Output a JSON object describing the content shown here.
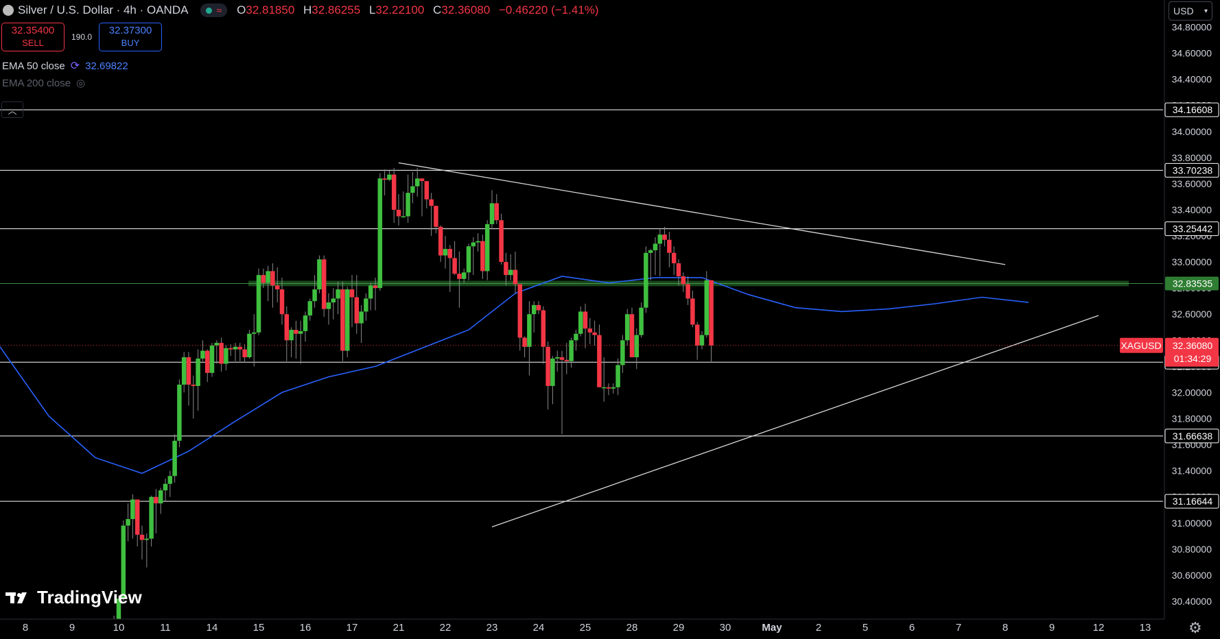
{
  "header": {
    "title": "Silver / U.S. Dollar · 4h · OANDA",
    "ohlc": {
      "o_label": "O",
      "o": "32.81850",
      "h_label": "H",
      "h": "32.86255",
      "l_label": "L",
      "l": "32.22100",
      "c_label": "C",
      "c": "32.36080",
      "change": "−0.46220 (−1.41%)"
    }
  },
  "trade": {
    "sell_price": "32.35400",
    "sell_label": "SELL",
    "spread": "190.0",
    "buy_price": "32.37300",
    "buy_label": "BUY"
  },
  "indicators": [
    {
      "label": "EMA 50 close",
      "value": "32.69822"
    },
    {
      "label": "EMA 200 close"
    }
  ],
  "currency": "USD",
  "logo": "TradingView",
  "colors": {
    "up": "#22ab94",
    "up_body": "#3fbf3f",
    "down": "#f23645",
    "ema": "#2962ff",
    "level": "#ffffff",
    "zone": "#2e7d32",
    "price": "#f23645"
  },
  "chart_data": {
    "type": "candlestick",
    "symbol": "XAGUSD",
    "interval": "4h",
    "ylim": [
      30.3,
      34.85
    ],
    "y_ticks": [
      "30.40000",
      "30.60000",
      "30.80000",
      "31.00000",
      "31.20000",
      "31.40000",
      "31.60000",
      "31.80000",
      "32.00000",
      "32.20000",
      "32.40000",
      "32.60000",
      "32.80000",
      "33.00000",
      "33.20000",
      "33.40000",
      "33.60000",
      "33.80000",
      "34.00000",
      "34.20000",
      "34.40000",
      "34.60000",
      "34.80000"
    ],
    "x_ticks": [
      "8",
      "9",
      "10",
      "11",
      "14",
      "15",
      "16",
      "17",
      "21",
      "22",
      "23",
      "24",
      "25",
      "28",
      "29",
      "30",
      "May",
      "2",
      "5",
      "6",
      "7",
      "8",
      "9",
      "12",
      "13"
    ],
    "price_label": {
      "symbol": "XAGUSD",
      "price": "32.36080",
      "countdown": "01:34:29"
    },
    "horizontal_levels": [
      34.16608,
      33.70238,
      33.25442,
      32.23249,
      31.66638,
      31.16644
    ],
    "level_labels": [
      "34.16608",
      "33.70238",
      "33.25442",
      "32.23249",
      "31.66638",
      "31.16644"
    ],
    "zone": {
      "value": 32.83535,
      "label": "32.83535"
    },
    "trendlines": [
      {
        "name": "descending-resistance",
        "points": [
          [
            "21",
            33.76
          ],
          [
            "8",
            32.98
          ]
        ]
      },
      {
        "name": "ascending-support",
        "points": [
          [
            "23",
            30.97
          ],
          [
            "12",
            32.59
          ]
        ]
      }
    ],
    "ema50": [
      [
        8,
        32.35
      ],
      [
        9,
        31.82
      ],
      [
        10,
        31.5
      ],
      [
        11,
        31.38
      ],
      [
        14,
        31.55
      ],
      [
        15,
        31.78
      ],
      [
        16,
        32.0
      ],
      [
        17,
        32.12
      ],
      [
        21,
        32.2
      ],
      [
        22,
        32.34
      ],
      [
        23,
        32.48
      ],
      [
        24,
        32.76
      ],
      [
        25,
        32.89
      ],
      [
        28,
        32.84
      ],
      [
        29,
        32.88
      ],
      [
        30,
        32.88
      ],
      [
        31,
        32.75
      ],
      [
        32,
        32.65
      ],
      [
        33,
        32.62
      ],
      [
        34,
        32.64
      ],
      [
        35,
        32.68
      ],
      [
        36,
        32.73
      ],
      [
        37,
        32.69
      ]
    ],
    "candles": [
      [
        2.0,
        30.26,
        30.29,
        30.19,
        30.24
      ],
      [
        2.1,
        30.24,
        30.45,
        30.2,
        30.42
      ],
      [
        2.2,
        30.42,
        31.02,
        30.4,
        30.98
      ],
      [
        2.3,
        30.98,
        31.15,
        30.86,
        31.03
      ],
      [
        2.4,
        31.03,
        31.22,
        30.88,
        31.18
      ],
      [
        2.5,
        31.18,
        31.18,
        30.82,
        30.91
      ],
      [
        2.6,
        30.91,
        30.98,
        30.72,
        30.87
      ],
      [
        2.7,
        30.87,
        30.92,
        30.66,
        30.88
      ],
      [
        2.8,
        30.88,
        31.21,
        30.82,
        31.2
      ],
      [
        2.9,
        31.2,
        31.26,
        30.92,
        31.15
      ],
      [
        3.0,
        31.15,
        31.27,
        31.07,
        31.25
      ],
      [
        3.1,
        31.25,
        31.34,
        31.17,
        31.3
      ],
      [
        3.2,
        31.3,
        31.4,
        31.2,
        31.36
      ],
      [
        3.3,
        31.36,
        31.68,
        31.31,
        31.63
      ],
      [
        3.4,
        31.63,
        32.1,
        31.58,
        32.06
      ],
      [
        3.5,
        32.06,
        32.31,
        32.0,
        32.27
      ],
      [
        3.6,
        32.27,
        32.31,
        31.9,
        32.06
      ],
      [
        3.7,
        32.06,
        32.13,
        31.8,
        32.05
      ],
      [
        3.8,
        32.05,
        32.33,
        31.86,
        32.26
      ],
      [
        3.9,
        32.26,
        32.4,
        32.24,
        32.32
      ],
      [
        4.0,
        32.32,
        32.33,
        32.08,
        32.15
      ],
      [
        4.1,
        32.15,
        32.38,
        32.12,
        32.36
      ],
      [
        4.2,
        32.36,
        32.4,
        32.22,
        32.38
      ],
      [
        4.3,
        32.38,
        32.42,
        32.16,
        32.22
      ],
      [
        4.4,
        32.22,
        32.36,
        32.17,
        32.34
      ],
      [
        4.5,
        32.34,
        32.37,
        32.28,
        32.33
      ],
      [
        4.6,
        32.33,
        32.38,
        32.24,
        32.35
      ],
      [
        4.7,
        32.35,
        32.38,
        32.24,
        32.33
      ],
      [
        4.8,
        32.33,
        32.37,
        32.23,
        32.27
      ],
      [
        4.9,
        32.27,
        32.48,
        32.26,
        32.45
      ],
      [
        5.0,
        32.45,
        32.6,
        32.2,
        32.46
      ],
      [
        5.1,
        32.46,
        32.95,
        32.44,
        32.9
      ],
      [
        5.2,
        32.9,
        32.95,
        32.8,
        32.84
      ],
      [
        5.3,
        32.84,
        32.97,
        32.7,
        32.93
      ],
      [
        5.4,
        32.93,
        32.99,
        32.65,
        32.82
      ],
      [
        5.5,
        32.82,
        32.96,
        32.69,
        32.79
      ],
      [
        5.6,
        32.79,
        32.88,
        32.52,
        32.6
      ],
      [
        5.7,
        32.6,
        32.66,
        32.24,
        32.4
      ],
      [
        5.8,
        32.4,
        32.5,
        32.27,
        32.48
      ],
      [
        5.9,
        32.48,
        32.55,
        32.26,
        32.45
      ],
      [
        6.0,
        32.45,
        32.55,
        32.22,
        32.47
      ],
      [
        6.1,
        32.47,
        32.62,
        32.39,
        32.59
      ],
      [
        6.2,
        32.59,
        32.72,
        32.55,
        32.7
      ],
      [
        6.3,
        32.7,
        32.9,
        32.65,
        32.79
      ],
      [
        6.4,
        32.79,
        33.05,
        32.76,
        33.02
      ],
      [
        6.5,
        33.02,
        33.05,
        32.58,
        32.64
      ],
      [
        6.6,
        32.64,
        32.76,
        32.52,
        32.69
      ],
      [
        6.7,
        32.69,
        32.8,
        32.56,
        32.72
      ],
      [
        6.8,
        32.72,
        32.85,
        32.6,
        32.79
      ],
      [
        6.9,
        32.79,
        32.85,
        32.24,
        32.32
      ],
      [
        7.0,
        32.32,
        32.81,
        32.27,
        32.79
      ],
      [
        7.1,
        32.79,
        32.9,
        32.5,
        32.73
      ],
      [
        7.2,
        32.73,
        32.9,
        32.45,
        32.53
      ],
      [
        7.3,
        32.53,
        32.67,
        32.38,
        32.62
      ],
      [
        7.4,
        32.62,
        32.76,
        32.55,
        32.72
      ],
      [
        7.5,
        32.72,
        32.84,
        32.63,
        32.82
      ],
      [
        7.6,
        32.82,
        32.88,
        32.63,
        32.8
      ],
      [
        7.7,
        32.8,
        33.68,
        32.78,
        33.64
      ],
      [
        7.8,
        33.64,
        33.71,
        33.51,
        33.63
      ],
      [
        7.9,
        33.63,
        33.7,
        33.62,
        33.67
      ],
      [
        8.0,
        33.67,
        33.72,
        33.3,
        33.4
      ],
      [
        8.1,
        33.4,
        33.52,
        33.28,
        33.35
      ],
      [
        8.2,
        33.35,
        33.54,
        33.34,
        33.35
      ],
      [
        8.3,
        33.35,
        33.67,
        33.3,
        33.53
      ],
      [
        8.4,
        33.53,
        33.69,
        33.45,
        33.58
      ],
      [
        8.5,
        33.58,
        33.72,
        33.5,
        33.64
      ],
      [
        8.6,
        33.64,
        33.64,
        33.35,
        33.62
      ],
      [
        8.7,
        33.62,
        33.62,
        33.41,
        33.48
      ],
      [
        8.8,
        33.48,
        33.53,
        33.2,
        33.43
      ],
      [
        8.9,
        33.43,
        33.43,
        33.22,
        33.27
      ],
      [
        9.0,
        33.27,
        33.28,
        33.0,
        33.05
      ],
      [
        9.1,
        33.05,
        33.2,
        32.95,
        33.1
      ],
      [
        9.2,
        33.1,
        33.13,
        32.77,
        33.03
      ],
      [
        9.3,
        33.03,
        33.16,
        32.9,
        32.91
      ],
      [
        9.4,
        32.91,
        33.08,
        32.65,
        32.87
      ],
      [
        9.5,
        32.87,
        32.95,
        32.84,
        32.92
      ],
      [
        9.6,
        32.92,
        33.14,
        32.86,
        33.12
      ],
      [
        9.7,
        33.12,
        33.19,
        32.9,
        33.15
      ],
      [
        9.8,
        33.15,
        33.22,
        33.08,
        33.16
      ],
      [
        9.9,
        33.16,
        33.21,
        32.87,
        32.93
      ],
      [
        10.0,
        32.93,
        33.32,
        32.86,
        33.29
      ],
      [
        10.1,
        33.29,
        33.55,
        33.25,
        33.45
      ],
      [
        10.2,
        33.45,
        33.52,
        33.29,
        33.32
      ],
      [
        10.3,
        33.32,
        33.37,
        32.98,
        33.0
      ],
      [
        10.4,
        33.0,
        33.07,
        32.82,
        32.9
      ],
      [
        10.5,
        32.9,
        33.06,
        32.86,
        32.94
      ],
      [
        10.6,
        32.94,
        33.08,
        32.76,
        32.83
      ],
      [
        10.7,
        32.83,
        32.83,
        32.32,
        32.42
      ],
      [
        10.8,
        32.42,
        32.43,
        32.27,
        32.35
      ],
      [
        10.9,
        32.35,
        32.7,
        32.13,
        32.6
      ],
      [
        11.0,
        32.6,
        32.7,
        32.46,
        32.67
      ],
      [
        11.1,
        32.67,
        32.7,
        32.6,
        32.63
      ],
      [
        11.2,
        32.63,
        32.66,
        32.22,
        32.35
      ],
      [
        11.3,
        32.35,
        32.39,
        31.87,
        32.05
      ],
      [
        11.4,
        32.05,
        32.28,
        31.91,
        32.26
      ],
      [
        11.5,
        32.26,
        32.32,
        32.16,
        32.27
      ],
      [
        11.6,
        32.27,
        32.32,
        31.68,
        32.25
      ],
      [
        11.7,
        32.25,
        32.38,
        32.14,
        32.24
      ],
      [
        11.8,
        32.24,
        32.42,
        32.19,
        32.4
      ],
      [
        11.9,
        32.4,
        32.48,
        32.32,
        32.45
      ],
      [
        12.0,
        32.45,
        32.66,
        32.43,
        32.62
      ],
      [
        12.1,
        32.62,
        32.68,
        32.34,
        32.49
      ],
      [
        12.2,
        32.49,
        32.57,
        32.37,
        32.46
      ],
      [
        12.3,
        32.46,
        32.55,
        32.36,
        32.44
      ],
      [
        12.4,
        32.44,
        32.52,
        32.16,
        32.04
      ],
      [
        12.5,
        32.04,
        32.27,
        31.93,
        32.04
      ],
      [
        12.6,
        32.04,
        32.07,
        31.98,
        32.03
      ],
      [
        12.7,
        32.03,
        32.07,
        31.99,
        32.04
      ],
      [
        12.8,
        32.04,
        32.26,
        31.98,
        32.21
      ],
      [
        12.9,
        32.21,
        32.44,
        32.15,
        32.4
      ],
      [
        13.0,
        32.4,
        32.64,
        32.36,
        32.6
      ],
      [
        13.1,
        32.6,
        32.65,
        32.31,
        32.27
      ],
      [
        13.2,
        32.27,
        32.49,
        32.18,
        32.44
      ],
      [
        13.3,
        32.44,
        32.69,
        32.42,
        32.65
      ],
      [
        13.4,
        32.65,
        33.12,
        32.61,
        33.07
      ],
      [
        13.5,
        33.07,
        33.1,
        32.86,
        33.09
      ],
      [
        13.6,
        33.09,
        33.19,
        32.9,
        33.14
      ],
      [
        13.7,
        33.14,
        33.26,
        32.89,
        33.21
      ],
      [
        13.8,
        33.21,
        33.27,
        33.12,
        33.17
      ],
      [
        13.9,
        33.17,
        33.23,
        32.96,
        33.07
      ],
      [
        14.0,
        33.07,
        33.12,
        32.9,
        32.99
      ],
      [
        14.1,
        32.99,
        33.02,
        32.82,
        32.89
      ],
      [
        14.2,
        32.89,
        32.92,
        32.77,
        32.83
      ],
      [
        14.3,
        32.83,
        32.89,
        32.67,
        32.72
      ],
      [
        14.4,
        32.72,
        32.78,
        32.5,
        32.52
      ],
      [
        14.5,
        32.52,
        32.54,
        32.25,
        32.36
      ],
      [
        14.6,
        32.36,
        32.47,
        32.33,
        32.44
      ],
      [
        14.7,
        32.44,
        32.93,
        32.42,
        32.86
      ],
      [
        14.8,
        32.86,
        32.86,
        32.23,
        32.36
      ]
    ]
  }
}
